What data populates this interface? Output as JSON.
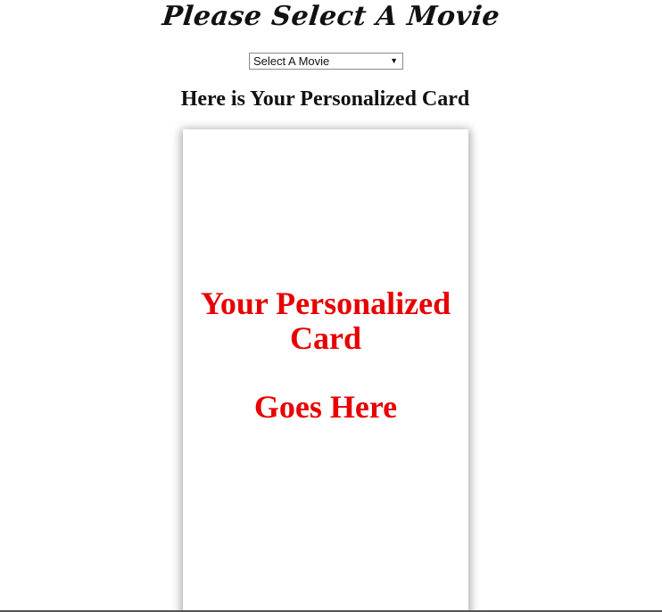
{
  "page": {
    "title": "Please Select A Movie",
    "heading": "Here is Your Personalized Card"
  },
  "movie_select": {
    "selected": "Select A Movie",
    "arrow": "▼"
  },
  "card": {
    "line1": "Your Personalized Card",
    "line2": "Goes Here",
    "text_color": "#e80000"
  }
}
